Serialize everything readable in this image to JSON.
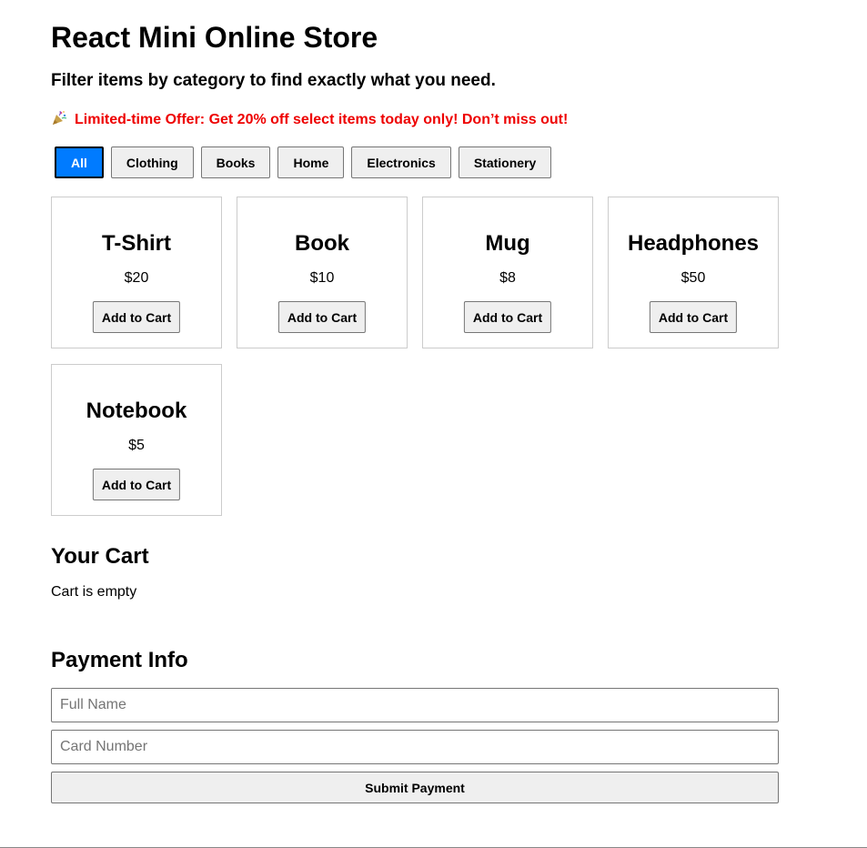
{
  "header": {
    "title": "React Mini Online Store",
    "subtitle": "Filter items by category to find exactly what you need.",
    "offer_icon": "party-popper-icon",
    "offer_text": "Limited-time Offer: Get 20% off select items today only! Don’t miss out!",
    "offer_color": "#ee0000"
  },
  "filters": {
    "active": "All",
    "active_color": "#007bff",
    "items": [
      "All",
      "Clothing",
      "Books",
      "Home",
      "Electronics",
      "Stationery"
    ]
  },
  "products": [
    {
      "name": "T-Shirt",
      "price": "$20",
      "button": "Add to Cart"
    },
    {
      "name": "Book",
      "price": "$10",
      "button": "Add to Cart"
    },
    {
      "name": "Mug",
      "price": "$8",
      "button": "Add to Cart"
    },
    {
      "name": "Headphones",
      "price": "$50",
      "button": "Add to Cart"
    },
    {
      "name": "Notebook",
      "price": "$5",
      "button": "Add to Cart"
    }
  ],
  "cart": {
    "heading": "Your Cart",
    "empty_text": "Cart is empty"
  },
  "payment": {
    "heading": "Payment Info",
    "name_placeholder": "Full Name",
    "name_value": "",
    "card_placeholder": "Card Number",
    "card_value": "",
    "submit_label": "Submit Payment"
  }
}
